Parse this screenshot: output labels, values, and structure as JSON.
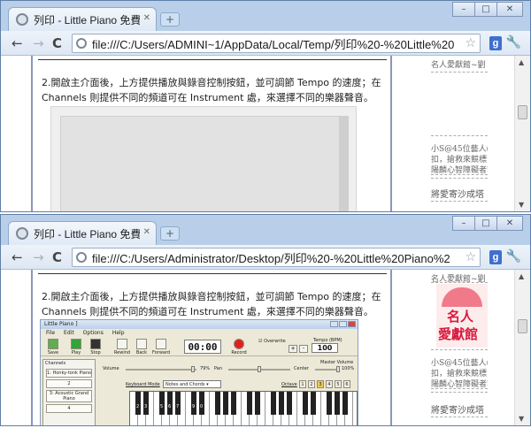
{
  "colors": {
    "frame": "#b9cfe9",
    "article_border": "#8a96bd",
    "ad_red": "#d81a3e"
  },
  "windows": [
    {
      "tab_title": "列印 - Little Piano 免費虛擬",
      "url": "file:///C:/Users/ADMINI~1/AppData/Local/Temp/列印%20-%20Little%20",
      "paragraph_line1": "2.開啟主介面後，上方提供播放與錄音控制按鈕，並可調節 Tempo 的速度；在",
      "paragraph_line2": "Channels 則提供不同的頻道可在 Instrument 處，來選擇不同的樂器聲音。",
      "sidebar_lines": [
        "名人愛獻館~劉",
        "小S@45位藝人(圖",
        "扣，搶救來競標，",
        "陽麟心智障礙者籌"
      ],
      "sidebar_heading": "將愛寄沙成塔"
    },
    {
      "tab_title": "列印 - Little Piano 免費虛擬",
      "url": "file:///C:/Users/Administrator/Desktop/列印%20-%20Little%20Piano%2",
      "paragraph_line1": "2.開啟主介面後，上方提供播放與錄音控制按鈕，並可調節 Tempo 的速度；在",
      "paragraph_line2": "Channels 則提供不同的頻道可在 Instrument 處，來選擇不同的樂器聲音。",
      "sidebar_lines": [
        "名人愛獻館~劉",
        "小S@45位藝人(圖",
        "扣，搶救來競標，",
        "陽麟心智障礙者籌"
      ],
      "sidebar_heading": "將愛寄沙成塔",
      "ad": {
        "line1": "名人",
        "line2": "愛獻館"
      }
    }
  ],
  "app": {
    "title": "Little Piano ]",
    "menu": [
      "File",
      "Edit",
      "Options",
      "Help"
    ],
    "tools": {
      "save": "Save",
      "play": "Play",
      "stop": "Stop",
      "rewind": "Rewind",
      "back": "Back",
      "forward": "Forward",
      "record": "Record"
    },
    "timer": "00:00",
    "overwrite": "Overwrite",
    "tempo_label": "Tempo (BPM)",
    "tempo_value": "100",
    "channels_header": "Channels",
    "channels": [
      "1: Honky-tonk Piano",
      "2",
      "3: Acoustic Grand Piano",
      "4"
    ],
    "volume_label": "Volume",
    "volume_value": "79%",
    "pan_label": "Pan",
    "pan_value": "Center",
    "master_label": "Master Volume",
    "master_value": "100%",
    "keyboard_mode_label": "Keyboard Mode",
    "keyboard_mode_value": "Notes and Chords",
    "octave_label": "Octave",
    "octaves": [
      "1",
      "2",
      "3",
      "4",
      "5",
      "6"
    ],
    "active_octave": "3",
    "key_labels": [
      "2",
      "3",
      "5",
      "6",
      "7",
      "9",
      "0"
    ]
  }
}
